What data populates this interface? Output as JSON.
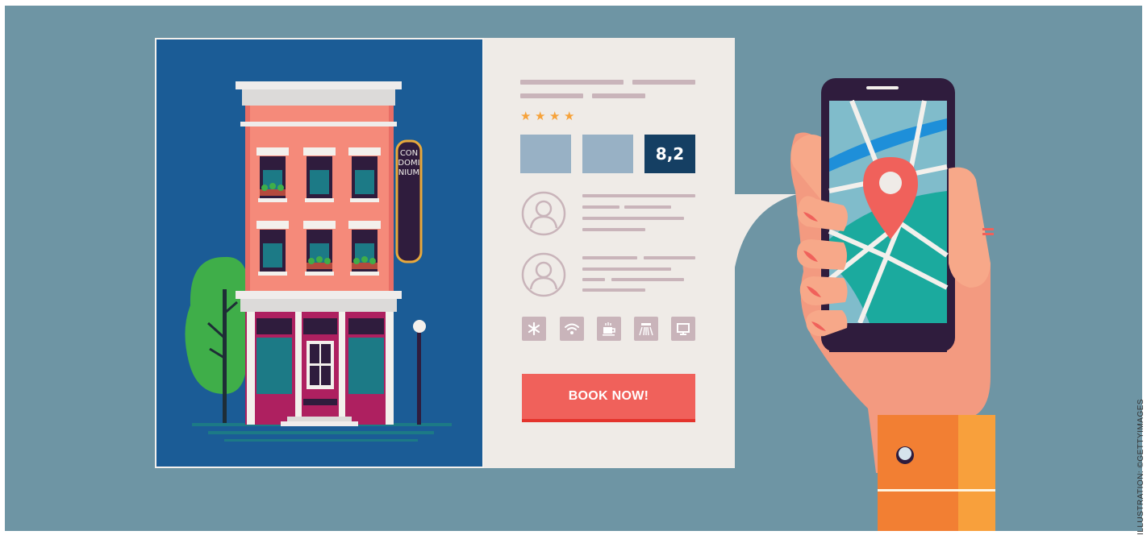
{
  "listing": {
    "sign_text": "CONDOMINIUM",
    "rating_stars": 4,
    "score": "8,2",
    "book_button_label": "BOOK NOW!",
    "amenities": [
      "snowflake-icon",
      "wifi-icon",
      "coffee-icon",
      "shower-icon",
      "tv-icon"
    ],
    "reviews": [
      "user-avatar-icon",
      "user-avatar-icon"
    ]
  },
  "phone": {
    "screen": "map",
    "marker": "location-pin-icon"
  },
  "credit": "ILLUSTRATION: ©GETTYIMAGES",
  "colors": {
    "background": "#6e95a4",
    "accent": "#f0615b",
    "score_box": "#153f63",
    "building": "#f58a7a",
    "sky": "#1b5c96"
  }
}
